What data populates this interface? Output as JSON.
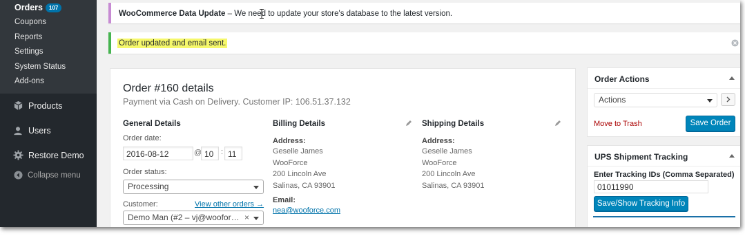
{
  "sidebar": {
    "orders_label": "Orders",
    "orders_count": "107",
    "sub_items": [
      "Coupons",
      "Reports",
      "Settings",
      "System Status",
      "Add-ons"
    ],
    "menu": [
      {
        "label": "Products",
        "icon": "cube-icon"
      },
      {
        "label": "Users",
        "icon": "user-icon"
      },
      {
        "label": "Restore Demo",
        "icon": "gear-icon"
      }
    ],
    "collapse_label": "Collapse menu"
  },
  "notices": {
    "update_title": "WooCommerce Data Update",
    "update_text": " – We need to update your store's database to the latest version.",
    "success_text": "Order updated and email sent."
  },
  "order": {
    "title": "Order #160 details",
    "subtitle": "Payment via Cash on Delivery. Customer IP: 106.51.37.132",
    "general": {
      "heading": "General Details",
      "date_label": "Order date:",
      "date_value": "2016-08-12",
      "at": "@",
      "hour": "10",
      "colon": ":",
      "minute": "11",
      "status_label": "Order status:",
      "status_value": "Processing",
      "customer_label": "Customer:",
      "view_orders_link": "View other orders →",
      "customer_value": "Demo Man (#2 – vj@woofor…",
      "clear_symbol": "×"
    },
    "billing": {
      "heading": "Billing Details",
      "address_label": "Address:",
      "address_lines": [
        "Geselle James",
        "WooForce",
        "200 Lincoln Ave",
        "Salinas, CA 93901"
      ],
      "email_label": "Email:",
      "email_value": "nea@wooforce.com"
    },
    "shipping": {
      "heading": "Shipping Details",
      "address_label": "Address:",
      "address_lines": [
        "Geselle James",
        "WooForce",
        "200 Lincoln Ave",
        "Salinas, CA 93901"
      ]
    }
  },
  "order_actions": {
    "title": "Order Actions",
    "select_value": "Actions",
    "trash_label": "Move to Trash",
    "save_label": "Save Order"
  },
  "ups": {
    "title": "UPS Shipment Tracking",
    "field_label": "Enter Tracking IDs (Comma Separated)",
    "field_value": "01011990",
    "button_label": "Save/Show Tracking Info"
  },
  "colors": {
    "sidebar_bg": "#23282d",
    "accent": "#0073aa",
    "button_primary": "#0085ba",
    "notice_purple": "#c78bd3",
    "notice_green": "#46b450",
    "highlight": "#f6f86b",
    "trash_red": "#a00"
  }
}
